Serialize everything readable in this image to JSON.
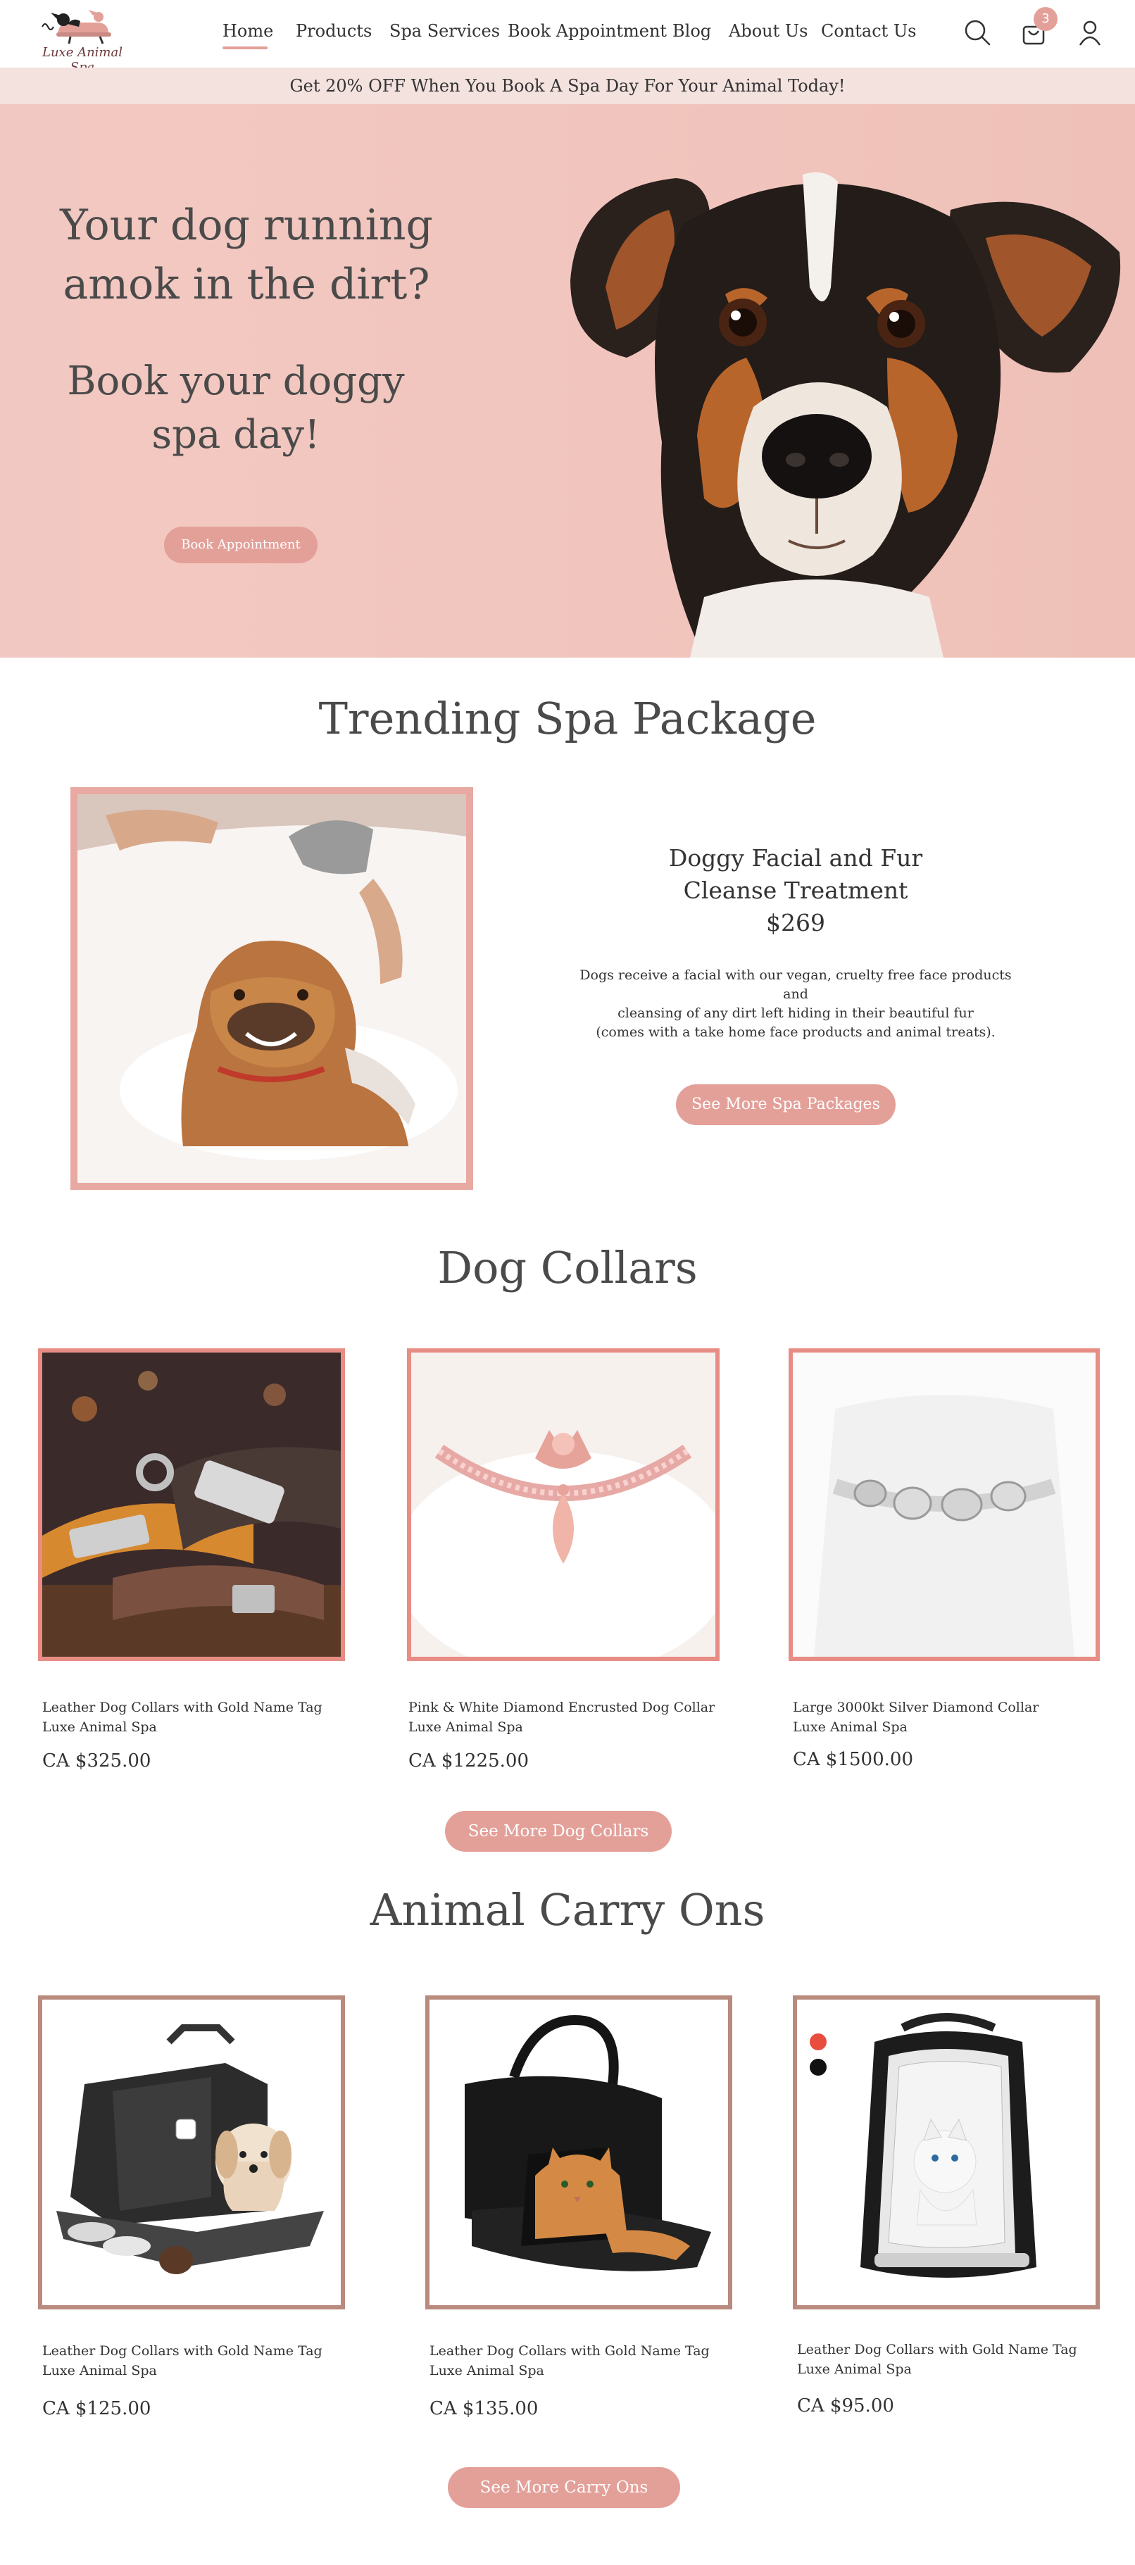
{
  "header": {
    "logo_text": "Luxe Animal Spa",
    "nav": [
      {
        "label": "Home"
      },
      {
        "label": "Products"
      },
      {
        "label": "Spa Services"
      },
      {
        "label": "Book Appointment"
      },
      {
        "label": "Blog"
      },
      {
        "label": "About Us"
      },
      {
        "label": "Contact Us"
      }
    ],
    "cart_count": "3",
    "icons": [
      "search-icon",
      "cart-icon",
      "account-icon"
    ]
  },
  "promo": {
    "text": "Get 20% OFF When You Book A Spa Day For Your Animal Today!"
  },
  "hero": {
    "headline": "Your dog running amok in the dirt?",
    "subheadline": "Book your doggy spa day!",
    "button": "Book Appointment"
  },
  "trending": {
    "title": "Trending Spa Package",
    "product_title_line1": "Doggy Facial and Fur",
    "product_title_line2": "Cleanse Treatment",
    "price": "$269",
    "desc_line1": "Dogs receive a facial with our vegan, cruelty free face products and",
    "desc_line2": "cleansing of any dirt left hiding in their beautiful fur",
    "desc_line3": "(comes with a take home face products and animal treats).",
    "button": "See More Spa Packages"
  },
  "collars": {
    "title": "Dog Collars",
    "items": [
      {
        "name": "Leather Dog Collars with Gold Name Tag",
        "vendor": "Luxe Animal Spa",
        "price": "CA $325.00"
      },
      {
        "name": "Pink & White Diamond Encrusted Dog Collar",
        "vendor": "Luxe Animal Spa",
        "price": "CA $1225.00"
      },
      {
        "name": "Large 3000kt Silver Diamond Collar",
        "vendor": "Luxe Animal Spa",
        "price": "CA $1500.00"
      }
    ],
    "button": "See More Dog Collars"
  },
  "carry": {
    "title": "Animal Carry Ons",
    "items": [
      {
        "name": "Leather Dog Collars with Gold Name Tag",
        "vendor": "Luxe Animal Spa",
        "price": "CA $125.00"
      },
      {
        "name": "Leather Dog Collars with Gold Name Tag",
        "vendor": "Luxe Animal Spa",
        "price": "CA $135.00"
      },
      {
        "name": "Leather Dog Collars with Gold Name Tag",
        "vendor": "Luxe Animal Spa",
        "price": "CA $95.00"
      }
    ],
    "button": "See More Carry Ons"
  },
  "colors": {
    "accent": "#e3a099",
    "hero_bg": "#f2c9c2",
    "promo_bg": "#f4e2df",
    "frame_brown": "#b98a7e"
  }
}
